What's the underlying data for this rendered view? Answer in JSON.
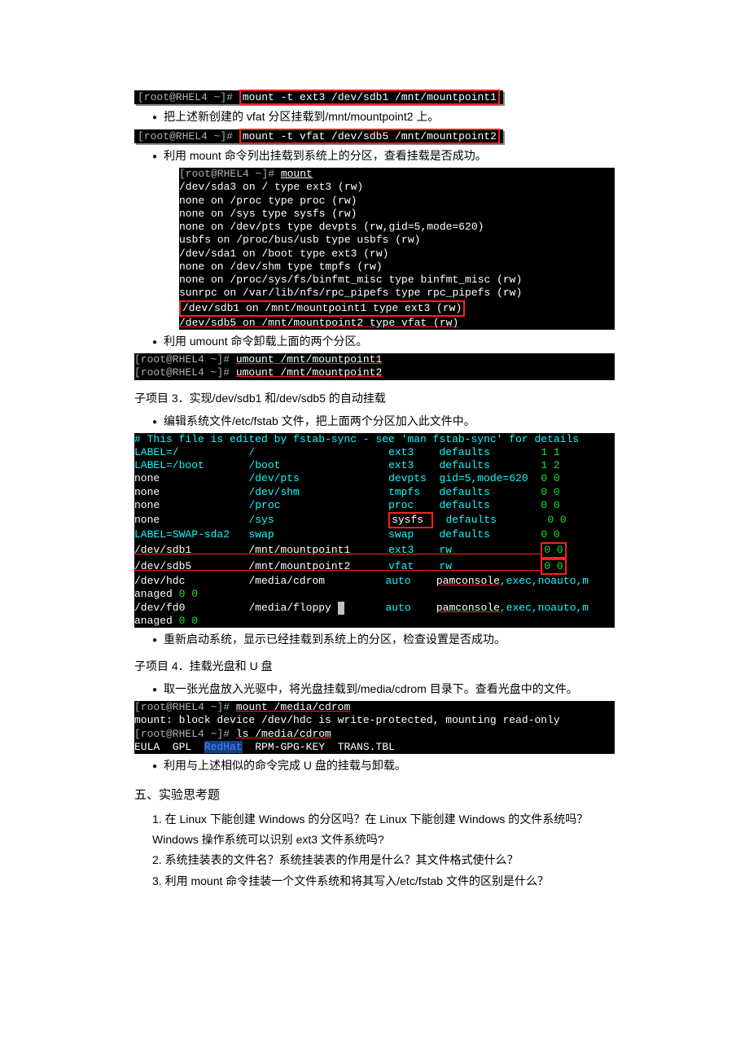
{
  "cmd1_prompt": "[root@RHEL4 ~]# ",
  "cmd1": "mount -t ext3 /dev/sdb1 /mnt/mountpoint1",
  "bul1": "把上述新创建的 vfat 分区挂载到/mnt/mountpoint2 上。",
  "cmd2_prompt": "[root@RHEL4 ~]# ",
  "cmd2": "mount -t vfat /dev/sdb5 /mnt/mountpoint2",
  "bul2": "利用 mount 命令列出挂载到系统上的分区，查看挂载是否成功。",
  "mount_out": {
    "prompt": "[root@RHEL4 ~]# ",
    "cmd": "mount",
    "lines": [
      "/dev/sda3 on / type ext3 (rw)",
      "none on /proc type proc (rw)",
      "none on /sys type sysfs (rw)",
      "none on /dev/pts type devpts (rw,gid=5,mode=620)",
      "usbfs on /proc/bus/usb type usbfs (rw)",
      "/dev/sda1 on /boot type ext3 (rw)",
      "none on /dev/shm type tmpfs (rw)",
      "none on /proc/sys/fs/binfmt_misc type binfmt_misc (rw)",
      "sunrpc on /var/lib/nfs/rpc_pipefs type rpc_pipefs (rw)"
    ],
    "boxed": [
      "/dev/sdb1 on /mnt/mountpoint1 type ext3 (rw)",
      "/dev/sdb5 on /mnt/mountpoint2 type vfat (rw)"
    ]
  },
  "bul3": "利用 umount 命令卸载上面的两个分区。",
  "umount": {
    "prompt": "[root@RHEL4 ~]# ",
    "c1": "umount /mnt/mountpoint1",
    "c2": "umount /mnt/mountpoint2"
  },
  "sub3": "子项目 3．实现/dev/sdb1 和/dev/sdb5 的自动挂载",
  "bul4": "编辑系统文件/etc/fstab 文件，把上面两个分区加入此文件中。",
  "fstab_header": "# This file is edited by fstab-sync - see 'man fstab-sync' for details",
  "fstab": [
    {
      "dev": "LABEL=/",
      "mnt": "/",
      "fs": "ext3",
      "opt": "defaults",
      "d": "1 1",
      "c": "cyan"
    },
    {
      "dev": "LABEL=/boot",
      "mnt": "/boot",
      "fs": "ext3",
      "opt": "defaults",
      "d": "1 2",
      "c": "cyan"
    },
    {
      "dev": "none",
      "mnt": "/dev/pts",
      "fs": "devpts",
      "opt": "gid=5,mode=620",
      "d": "0 0",
      "c": "white"
    },
    {
      "dev": "none",
      "mnt": "/dev/shm",
      "fs": "tmpfs",
      "opt": "defaults",
      "d": "0 0",
      "c": "white"
    },
    {
      "dev": "none",
      "mnt": "/proc",
      "fs": "proc",
      "opt": "defaults",
      "d": "0 0",
      "c": "white"
    },
    {
      "dev": "none",
      "mnt": "/sys",
      "fs": "sysfs",
      "opt": "defaults",
      "d": "0 0",
      "c": "white",
      "fsbox": true
    },
    {
      "dev": "LABEL=SWAP-sda2",
      "mnt": "swap",
      "fs": "swap",
      "opt": "defaults",
      "d": "0 0",
      "c": "cyan"
    }
  ],
  "fstab_add": [
    {
      "dev": "/dev/sdb1",
      "mnt": "/mnt/mountpoint1",
      "fs": "ext3",
      "opt": "rw",
      "d": "0 0"
    },
    {
      "dev": "/dev/sdb5",
      "mnt": "/mnt/mountpoint2",
      "fs": "vfat",
      "opt": "rw",
      "d": "0 0"
    }
  ],
  "fstab_tail": [
    {
      "dev": "/dev/hdc",
      "mnt": "/media/cdrom",
      "fs": "auto",
      "opt_pre": "pamconsole",
      "opt_rest": ",exec,noauto,m",
      "wrap": "anaged 0 0"
    },
    {
      "dev": "/dev/fd0",
      "mnt": "/media/floppy",
      "fs": "auto",
      "opt_pre": "pamconsole",
      "opt_rest": ",exec,noauto,m",
      "wrap": "anaged 0 0",
      "cursor": true
    }
  ],
  "bul5": "重新启动系统，显示已经挂载到系统上的分区，检查设置是否成功。",
  "sub4": "子项目 4．挂载光盘和 U 盘",
  "bul6": "取一张光盘放入光驱中，将光盘挂载到/media/cdrom 目录下。查看光盘中的文件。",
  "cdrom": {
    "p1": "[root@RHEL4 ~]# ",
    "c1": "mount /media/cdrom",
    "l1": "mount: block device /dev/hdc is write-protected, mounting read-only",
    "p2": "[root@RHEL4 ~]# ",
    "c2": "ls /media/cdrom",
    "ls": "EULA  GPL  RedHat  RPM-GPG-KEY  TRANS.TBL"
  },
  "bul7": "利用与上述相似的命令完成 U 盘的挂载与卸载。",
  "sec5": "五、实验思考题",
  "q1": "1.  在 Linux 下能创建 Windows  的分区吗？在 Linux 下能创建 Windows 的文件系统吗？Windows 操作系统可以识别 ext3 文件系统吗?",
  "q2": "2.  系统挂装表的文件名？系统挂装表的作用是什么？其文件格式使什么？",
  "q3": "3.  利用 mount 命令挂装一个文件系统和将其写入/etc/fstab 文件的区别是什么？"
}
